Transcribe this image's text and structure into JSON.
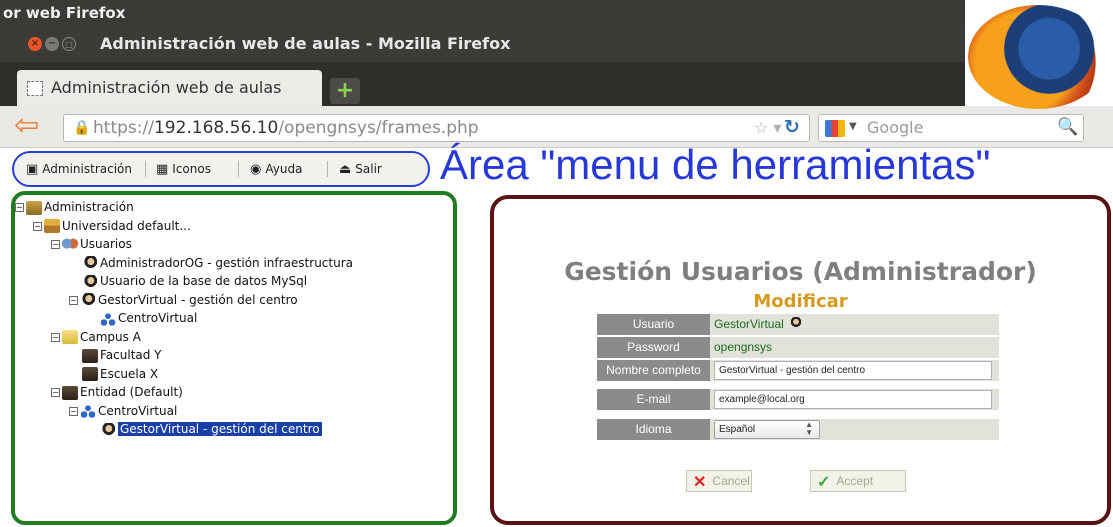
{
  "outer_window": {
    "title": "or web Firefox"
  },
  "window": {
    "title": "Administración web de aulas - Mozilla Firefox",
    "close_glyph": "×",
    "min_glyph": "−",
    "max_glyph": "□"
  },
  "tabs": [
    {
      "label": "Administración web de aulas"
    }
  ],
  "newtab_glyph": "+",
  "navbar": {
    "back_glyph": "⇦",
    "url_prefix": "https://",
    "url_host": "192.168.56.10",
    "url_path": "/opengnsys/frames.php",
    "search_placeholder": "Google"
  },
  "menubar": {
    "items": [
      {
        "label": "Administración"
      },
      {
        "label": "Iconos"
      },
      {
        "label": "Ayuda"
      },
      {
        "label": "Salir"
      }
    ]
  },
  "annotation": {
    "label": "Área \"menu de herramientas\""
  },
  "tree": {
    "nodes": [
      {
        "label": "Administración",
        "depth": 0,
        "icon": "admin-icon",
        "expander": "−"
      },
      {
        "label": "Universidad default...",
        "depth": 1,
        "icon": "house-icon",
        "expander": "−"
      },
      {
        "label": "Usuarios",
        "depth": 2,
        "icon": "users-icon",
        "expander": "−"
      },
      {
        "label": "AdministradorOG - gestión infraestructura",
        "depth": 3,
        "icon": "user-icon",
        "expander": ""
      },
      {
        "label": "Usuario de la base de datos MySql",
        "depth": 3,
        "icon": "user-icon",
        "expander": ""
      },
      {
        "label": "GestorVirtual - gestión del centro",
        "depth": 3,
        "icon": "user-icon",
        "expander": "−"
      },
      {
        "label": "CentroVirtual",
        "depth": 4,
        "icon": "network-icon",
        "expander": ""
      },
      {
        "label": "Campus A",
        "depth": 2,
        "icon": "folder-icon",
        "expander": "−"
      },
      {
        "label": "Facultad Y",
        "depth": 3,
        "icon": "building-icon",
        "expander": ""
      },
      {
        "label": "Escuela X",
        "depth": 3,
        "icon": "building-icon",
        "expander": ""
      },
      {
        "label": "Entidad (Default)",
        "depth": 2,
        "icon": "building-icon",
        "expander": "−"
      },
      {
        "label": "CentroVirtual",
        "depth": 3,
        "icon": "network-icon",
        "expander": "−"
      },
      {
        "label": "GestorVirtual - gestión del centro",
        "depth": 4,
        "icon": "user-icon",
        "expander": "",
        "selected": true
      }
    ]
  },
  "content": {
    "title": "Gestión Usuarios (Administrador)",
    "subtitle": "Modificar",
    "fields": [
      {
        "label": "Usuario",
        "value": "GestorVirtual",
        "kind": "text"
      },
      {
        "label": "Password",
        "value": "opengnsys",
        "kind": "text"
      },
      {
        "label": "Nombre completo",
        "value": "GestorVirtual - gestión del centro",
        "kind": "input"
      },
      {
        "label": "E-mail",
        "value": "example@local.org",
        "kind": "input"
      },
      {
        "label": "Idioma",
        "value": "Español",
        "kind": "select"
      }
    ],
    "cancel_label": "Cancel",
    "accept_label": "Accept",
    "cancel_glyph": "✕",
    "accept_glyph": "✓"
  },
  "colors": {
    "menu_annotation": "#2738d8",
    "tree_frame": "#1f7d1f",
    "content_frame": "#5a1212",
    "title_gray": "#7f7f7f",
    "subtitle_gold": "#d79a1e",
    "selected_bg": "#1a3fa6"
  }
}
